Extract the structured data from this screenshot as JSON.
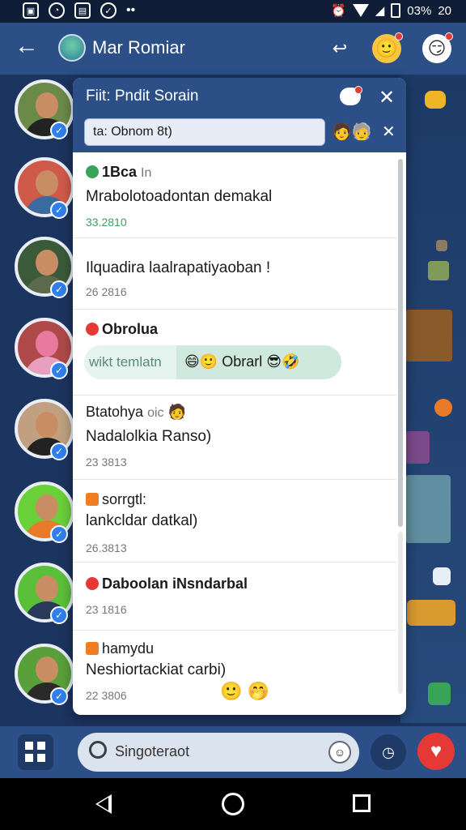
{
  "status_bar": {
    "battery_text": "03%",
    "time": "20"
  },
  "app_bar": {
    "title": "Mar Romiar"
  },
  "popup": {
    "title": "Fiit: Pndit Sorain",
    "filter_text": "ta: Obnom 8t)",
    "items": [
      {
        "name": "1Bca",
        "name_extra": "In",
        "text": "Mrabolotoadontan demakal",
        "time": "33.2810",
        "dot_color": "#3aa35a"
      },
      {
        "name": "",
        "text": "Ilquadira laalrapatiyaoban !",
        "time": "26 2816",
        "dot_color": ""
      },
      {
        "name": "Obrolua",
        "chip_left": "wikt temlatn",
        "chip_right": "Obrarl",
        "text": "",
        "time": "",
        "dot_color": "#e53935"
      },
      {
        "name": "Btatohya",
        "name_extra": "oic",
        "text": "Nadalolkia Ranso)",
        "time": "23 3813",
        "dot_color": ""
      },
      {
        "name": "sorrgtl:",
        "text": "lankcldar datkal)",
        "time": "26.3813",
        "dot_color": "#ef7d22"
      },
      {
        "name": "Daboolan iNsndarbal",
        "text": "",
        "time": "23 1816",
        "dot_color": "#e53935"
      },
      {
        "name": "hamydu",
        "text": "Neshiortackiat carbi)",
        "time": "22 3806",
        "dot_color": "#ef7d22"
      }
    ]
  },
  "bottom_bar": {
    "search_placeholder": "Singoteraot"
  },
  "colors": {
    "accent": "#2b4f86",
    "background": "#1c3460",
    "verified": "#2f80ed",
    "heart": "#e53935"
  }
}
